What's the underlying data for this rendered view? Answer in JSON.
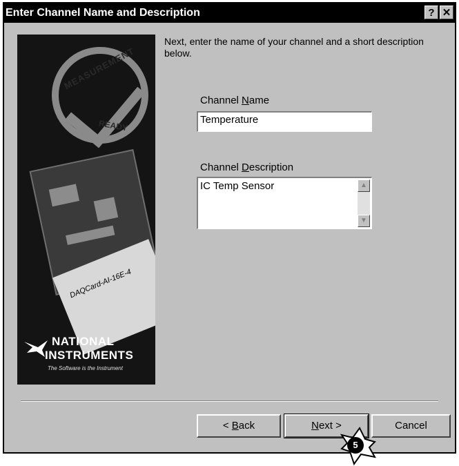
{
  "window": {
    "title": "Enter Channel Name and Description",
    "help_glyph": "?",
    "close_glyph": "✕"
  },
  "side_image": {
    "stamp_top": "MEASUREMENT",
    "stamp_bottom": "READY",
    "card_label": "DAQCard-AI-16E-4",
    "logo_line1": "NATIONAL",
    "logo_line2": "INSTRUMENTS",
    "logo_tagline": "The Software is the Instrument"
  },
  "instruction": "Next, enter the name of your channel and a short description below.",
  "channel_name": {
    "label_pre": "Channel ",
    "label_mnemonic": "N",
    "label_post": "ame",
    "value": "Temperature"
  },
  "channel_description": {
    "label_pre": "Channel ",
    "label_mnemonic": "D",
    "label_post": "escription",
    "value": "IC Temp Sensor"
  },
  "buttons": {
    "back_pre": "< ",
    "back_mnemonic": "B",
    "back_post": "ack",
    "next_mnemonic": "N",
    "next_post": "ext >",
    "cancel": "Cancel"
  },
  "callout": {
    "number": "5"
  },
  "colors": {
    "titlebar": "#000000",
    "dialog_face": "#c0c0c0",
    "side_panel": "#141414"
  }
}
